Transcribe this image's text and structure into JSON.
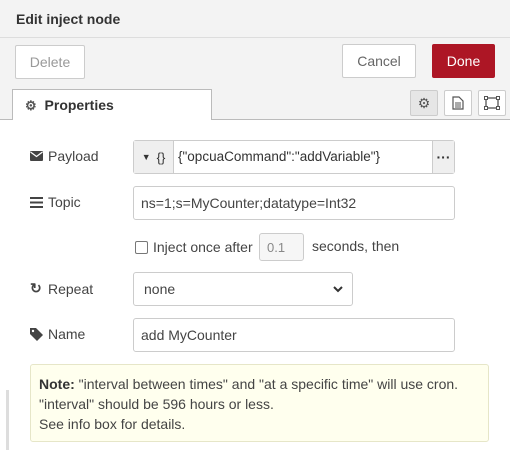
{
  "window": {
    "title": "Edit inject node"
  },
  "toolbar": {
    "delete_label": "Delete",
    "cancel_label": "Cancel",
    "done_label": "Done"
  },
  "tabs": {
    "properties_label": "Properties"
  },
  "form": {
    "payload": {
      "label": "Payload",
      "type_glyph": "{}",
      "value": "{\"opcuaCommand\":\"addVariable\"}"
    },
    "topic": {
      "label": "Topic",
      "value": "ns=1;s=MyCounter;datatype=Int32"
    },
    "inject_once": {
      "label": "Inject once after",
      "delay_value": "0.1",
      "suffix": "seconds, then"
    },
    "repeat": {
      "label": "Repeat",
      "value": "none"
    },
    "name": {
      "label": "Name",
      "value": "add MyCounter"
    }
  },
  "note": {
    "prefix": "Note:",
    "line1": "\"interval between times\" and \"at a specific time\" will use cron.",
    "line2": "\"interval\" should be 596 hours or less.",
    "line3": "See info box for details."
  },
  "colors": {
    "done_button": "#ad1625",
    "note_background": "#ffffee"
  },
  "icons": [
    "gear-icon",
    "envelope-icon",
    "list-icon",
    "document-icon",
    "frame-icon",
    "repeat-icon",
    "tag-icon",
    "chevron-down-icon",
    "dropdown-caret-icon",
    "ellipsis-icon"
  ]
}
